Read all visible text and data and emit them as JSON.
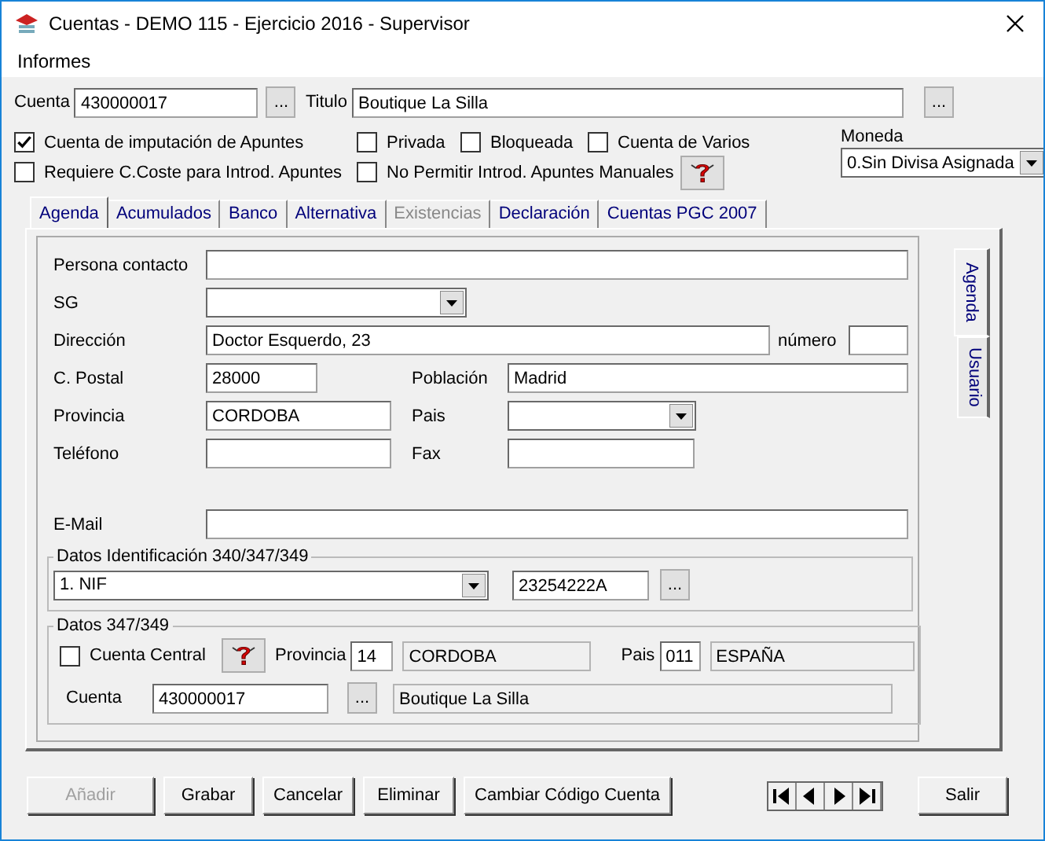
{
  "window": {
    "title": "Cuentas - DEMO 115 - Ejercicio 2016 - Supervisor"
  },
  "menu": [
    "Informes"
  ],
  "header": {
    "cuenta_label": "Cuenta",
    "cuenta_value": "430000017",
    "cuenta_button": "...",
    "titulo_label": "Titulo",
    "titulo_value": "Boutique La Silla",
    "titulo_button": "..."
  },
  "options_row1": [
    {
      "label": "Cuenta de imputación de Apuntes",
      "checked": true
    },
    {
      "label": "Privada",
      "checked": false
    },
    {
      "label": "Bloqueada",
      "checked": false
    },
    {
      "label": "Cuenta de Varios",
      "checked": false
    }
  ],
  "options_row2": [
    {
      "label": "Requiere C.Coste para Introd. Apuntes",
      "checked": false
    },
    {
      "label": "No Permitir Introd. Apuntes Manuales",
      "checked": false
    }
  ],
  "moneda": {
    "label": "Moneda",
    "value": "0.Sin Divisa Asignada"
  },
  "tabs": [
    {
      "label": "Agenda",
      "selected": true,
      "disabled": false
    },
    {
      "label": "Acumulados",
      "selected": false,
      "disabled": false
    },
    {
      "label": "Banco",
      "selected": false,
      "disabled": false
    },
    {
      "label": "Alternativa",
      "selected": false,
      "disabled": false
    },
    {
      "label": "Existencias",
      "selected": false,
      "disabled": true
    },
    {
      "label": "Declaración",
      "selected": false,
      "disabled": false
    },
    {
      "label": "Cuentas PGC 2007",
      "selected": false,
      "disabled": false
    }
  ],
  "side_tabs": [
    {
      "label": "Agenda",
      "selected": true
    },
    {
      "label": "Usuario",
      "selected": false
    }
  ],
  "agenda": {
    "persona_label": "Persona contacto",
    "sg_label": "SG",
    "direccion_label": "Dirección",
    "direccion_value": "Doctor Esquerdo, 23",
    "numero_label": "número",
    "cpostal_label": "C. Postal",
    "cpostal_value": "28000",
    "poblacion_label": "Población",
    "poblacion_value": "Madrid",
    "provincia_label": "Provincia",
    "provincia_value": "CORDOBA",
    "pais_label": "Pais",
    "telefono_label": "Teléfono",
    "fax_label": "Fax",
    "email_label": "E-Mail"
  },
  "identificacion": {
    "title": "Datos Identificación 340/347/349",
    "tipo": "1. NIF",
    "nif": "23254222A",
    "button": "..."
  },
  "datos347": {
    "title": "Datos 347/349",
    "central_label": "Cuenta Central",
    "central_checked": false,
    "provincia_label": "Provincia",
    "provincia_code": "14",
    "provincia_name": "CORDOBA",
    "pais_label": "Pais",
    "pais_code": "011",
    "pais_name": "ESPAÑA",
    "cuenta_label": "Cuenta",
    "cuenta_value": "430000017",
    "cuenta_button": "...",
    "cuenta_name": "Boutique La Silla"
  },
  "buttons": [
    {
      "label": "Añadir",
      "disabled": true
    },
    {
      "label": "Grabar",
      "disabled": false
    },
    {
      "label": "Cancelar",
      "disabled": false
    },
    {
      "label": "Eliminar",
      "disabled": false
    },
    {
      "label": "Cambiar Código Cuenta",
      "disabled": false
    }
  ],
  "exit_button": {
    "label": "Salir",
    "disabled": false
  }
}
